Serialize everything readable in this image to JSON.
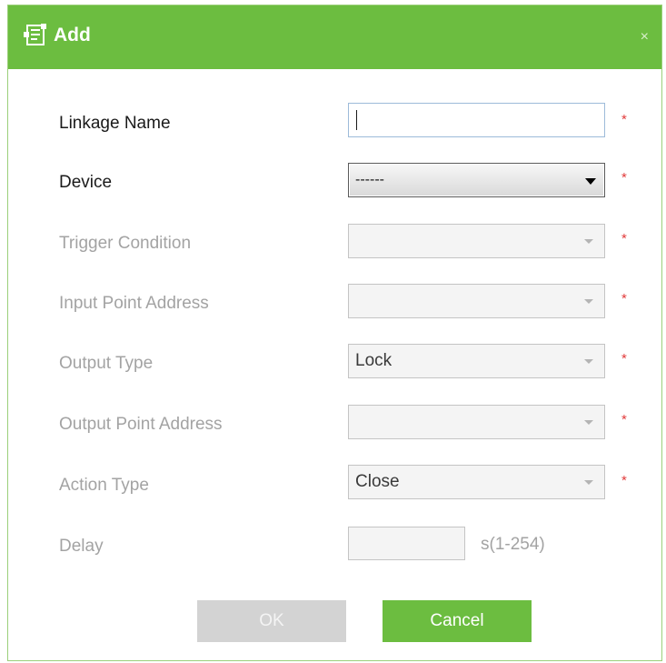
{
  "dialog": {
    "title": "Add",
    "close_glyph": "×",
    "icon": "form-edit-icon"
  },
  "fields": {
    "linkage_name": {
      "label": "Linkage Name",
      "value": "",
      "required_mark": "*"
    },
    "device": {
      "label": "Device",
      "selected": "------",
      "required_mark": "*"
    },
    "trigger_condition": {
      "label": "Trigger Condition",
      "selected": "",
      "required_mark": "*"
    },
    "input_point_address": {
      "label": "Input Point Address",
      "selected": "",
      "required_mark": "*"
    },
    "output_type": {
      "label": "Output Type",
      "selected": "Lock",
      "required_mark": "*"
    },
    "output_point_address": {
      "label": "Output Point Address",
      "selected": "",
      "required_mark": "*"
    },
    "action_type": {
      "label": "Action Type",
      "selected": "Close",
      "required_mark": "*"
    },
    "delay": {
      "label": "Delay",
      "value": "",
      "unit": "s(1-254)"
    }
  },
  "buttons": {
    "ok_label": "OK",
    "cancel_label": "Cancel"
  },
  "colors": {
    "titlebar": "#6cbd40",
    "required": "#e23b3b",
    "disabled_button": "#d3d3d3",
    "primary_button": "#6cbd40"
  }
}
